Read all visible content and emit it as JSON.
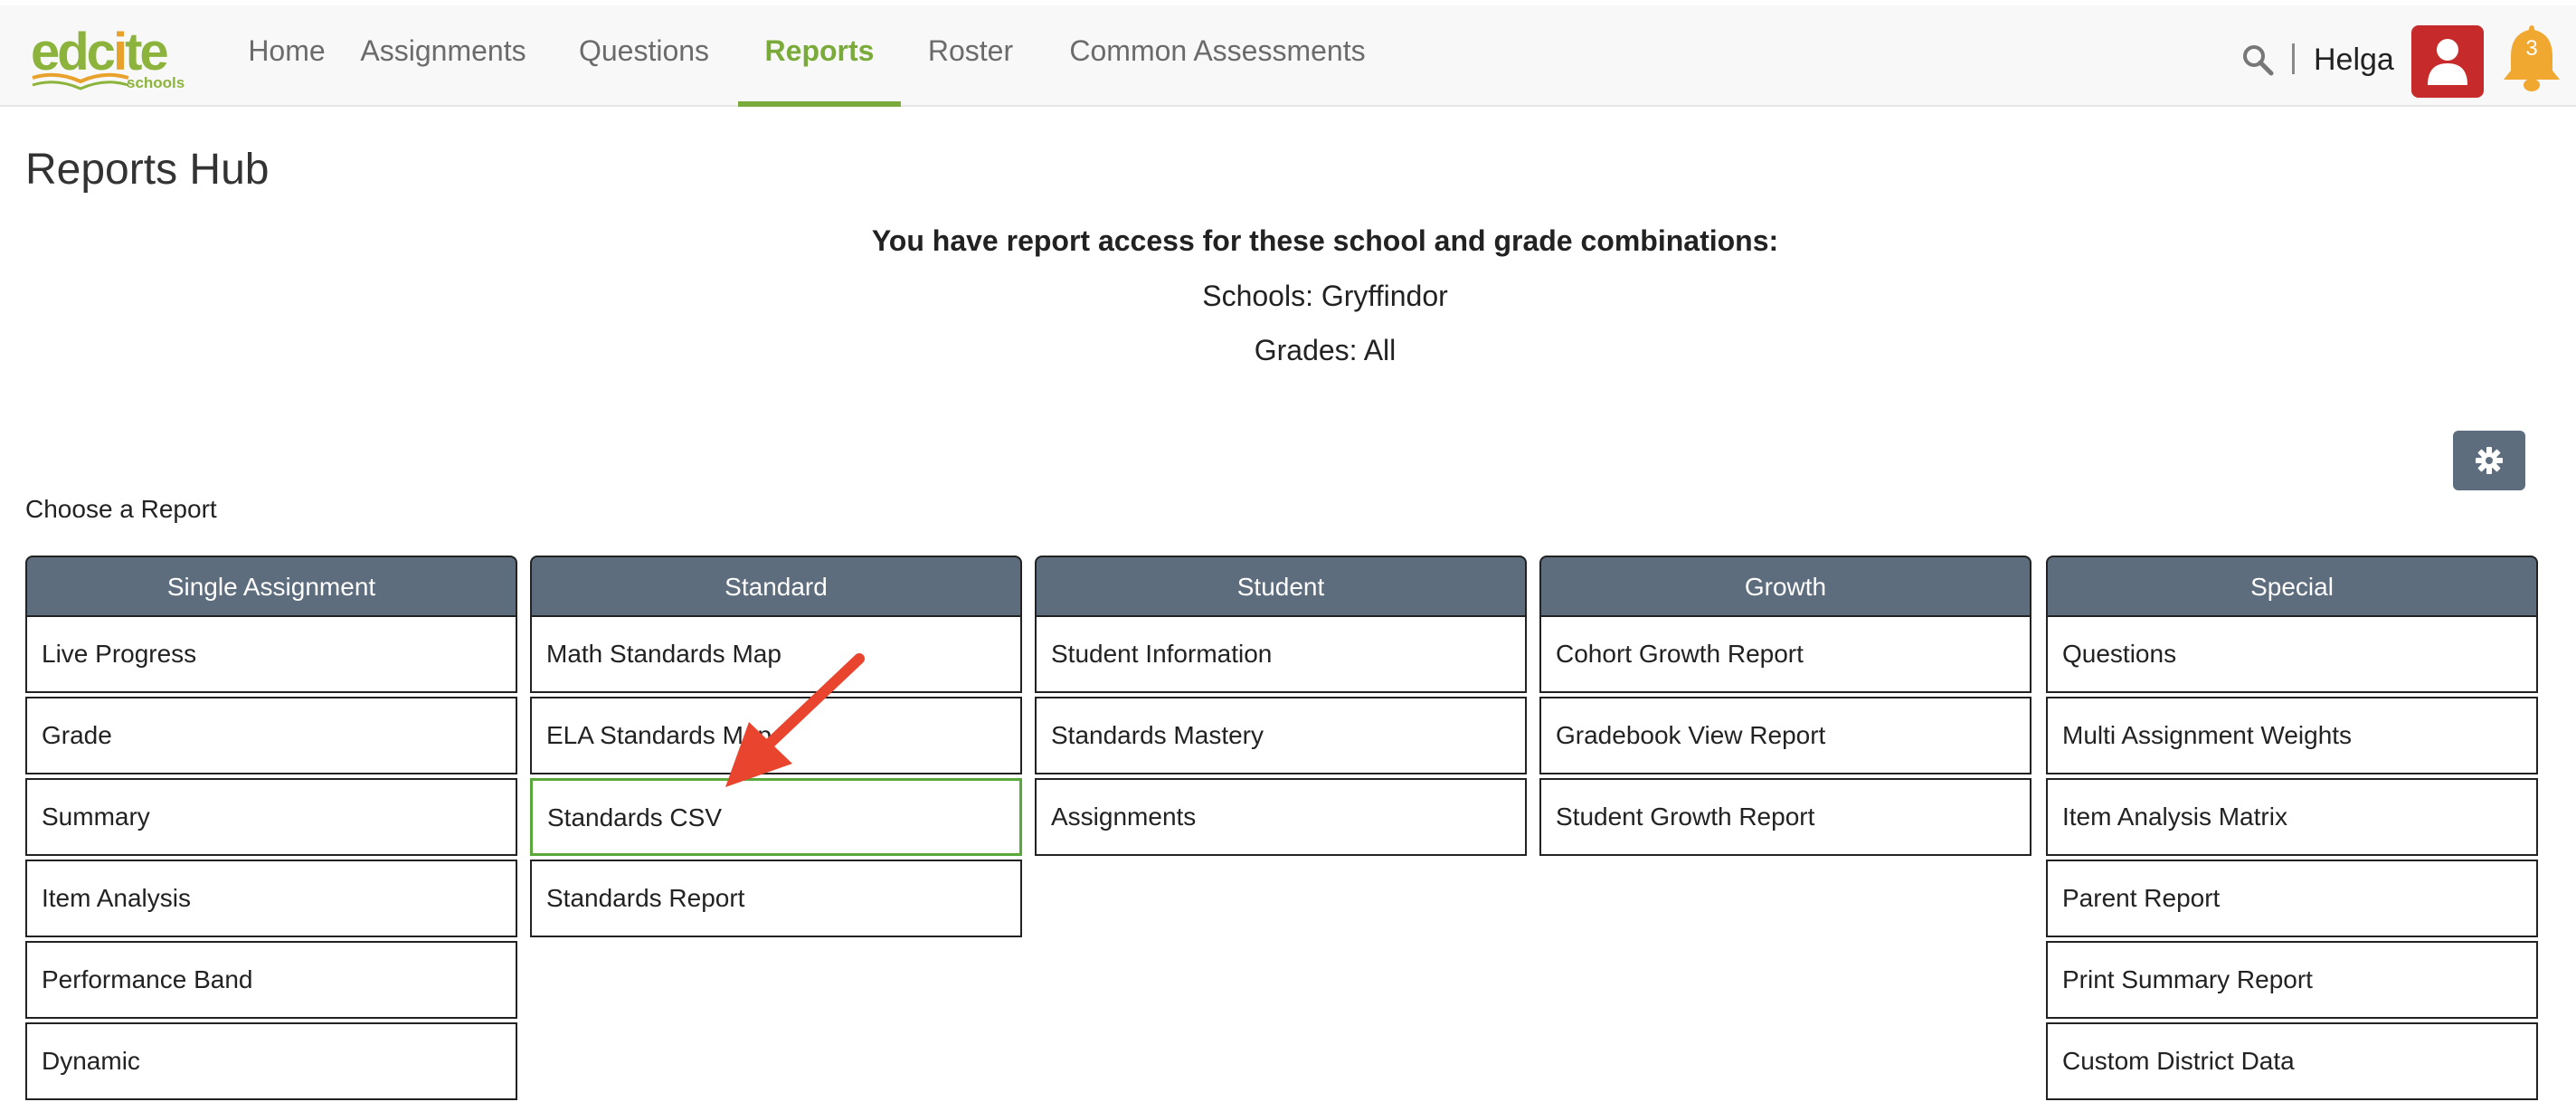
{
  "brand": {
    "name_part1": "edc",
    "name_part2": "i",
    "name_part3": "te",
    "sub": "schools"
  },
  "nav": {
    "items": [
      {
        "label": "Home"
      },
      {
        "label": "Assignments"
      },
      {
        "label": "Questions"
      },
      {
        "label": "Reports"
      },
      {
        "label": "Roster"
      },
      {
        "label": "Common Assessments"
      }
    ],
    "active": "Reports",
    "user_name": "Helga",
    "notification_count": "3"
  },
  "page": {
    "title": "Reports Hub",
    "access_heading": "You have report access for these school and grade combinations:",
    "schools": "Schools: Gryffindor",
    "grades": "Grades: All",
    "choose_label": "Choose a Report"
  },
  "columns": [
    {
      "title": "Single Assignment",
      "items": [
        "Live Progress",
        "Grade",
        "Summary",
        "Item Analysis",
        "Performance Band",
        "Dynamic"
      ]
    },
    {
      "title": "Standard",
      "items": [
        "Math Standards Map",
        "ELA Standards Map",
        "Standards CSV",
        "Standards Report"
      ]
    },
    {
      "title": "Student",
      "items": [
        "Student Information",
        "Standards Mastery",
        "Assignments"
      ]
    },
    {
      "title": "Growth",
      "items": [
        "Cohort Growth Report",
        "Gradebook View Report",
        "Student Growth Report"
      ]
    },
    {
      "title": "Special",
      "items": [
        "Questions",
        "Multi Assignment Weights",
        "Item Analysis Matrix",
        "Parent Report",
        "Print Summary Report",
        "Custom District Data"
      ]
    }
  ],
  "highlighted_item": "Standards CSV",
  "colors": {
    "accent": "#7aab3a",
    "header": "#5d6d7e",
    "avatar": "#c62a2a",
    "bell": "#f0a830",
    "arrow": "#e8442e"
  },
  "icons": {
    "search": "search-icon",
    "avatar": "user-icon",
    "bell": "bell-icon",
    "settings": "gear-icon",
    "arrow": "arrow-annotation-icon"
  }
}
